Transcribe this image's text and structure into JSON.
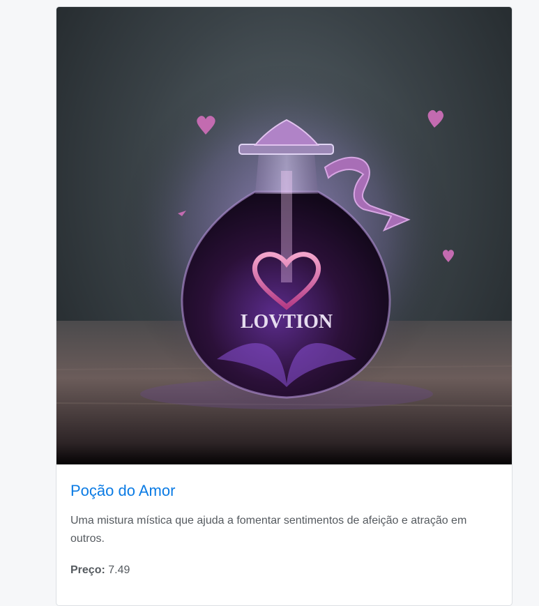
{
  "product": {
    "image_alt": "Poção do Amor",
    "image_label": "LOVTION",
    "title": "Poção do Amor",
    "description": "Uma mistura mística que ajuda a fomentar sentimentos de afeição e atração em outros.",
    "price_label": "Preço:",
    "price_value": "7.49"
  },
  "colors": {
    "page_background": "#f6f7f9",
    "title_link": "#0b7be4",
    "body_text": "#555a5f",
    "card_border": "#dcdfe3"
  }
}
